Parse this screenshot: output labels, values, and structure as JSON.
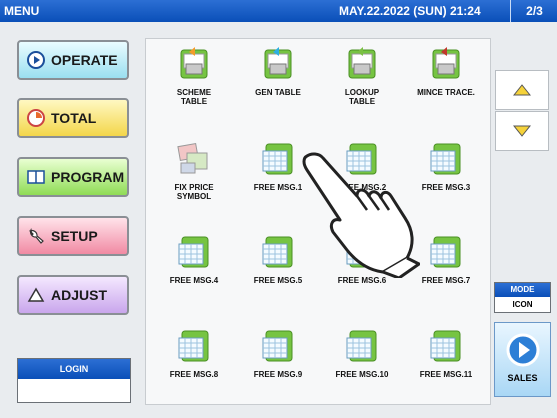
{
  "header": {
    "menu": "MENU",
    "datetime": "MAY.22.2022 (SUN)  21:24",
    "page": "2/3"
  },
  "nav": {
    "operate": "OPERATE",
    "total": "TOTAL",
    "program": "PROGRAM",
    "setup": "SETUP",
    "adjust": "ADJUST"
  },
  "login": {
    "label": "LOGIN",
    "value": ""
  },
  "items": [
    "SCHEME\nTABLE",
    "GEN TABLE",
    "LOOKUP\nTABLE",
    "MINCE TRACE.",
    "FIX PRICE\nSYMBOL",
    "FREE MSG.1",
    "FREE MSG.2",
    "FREE MSG.3",
    "FREE MSG.4",
    "FREE MSG.5",
    "FREE MSG.6",
    "FREE MSG.7",
    "FREE MSG.8",
    "FREE MSG.9",
    "FREE MSG.10",
    "FREE MSG.11"
  ],
  "mode": {
    "label": "MODE",
    "value": "ICON"
  },
  "sales": {
    "label": "SALES"
  },
  "colors": {
    "header": "#0a4fb8",
    "accent_green": "#76c442"
  }
}
